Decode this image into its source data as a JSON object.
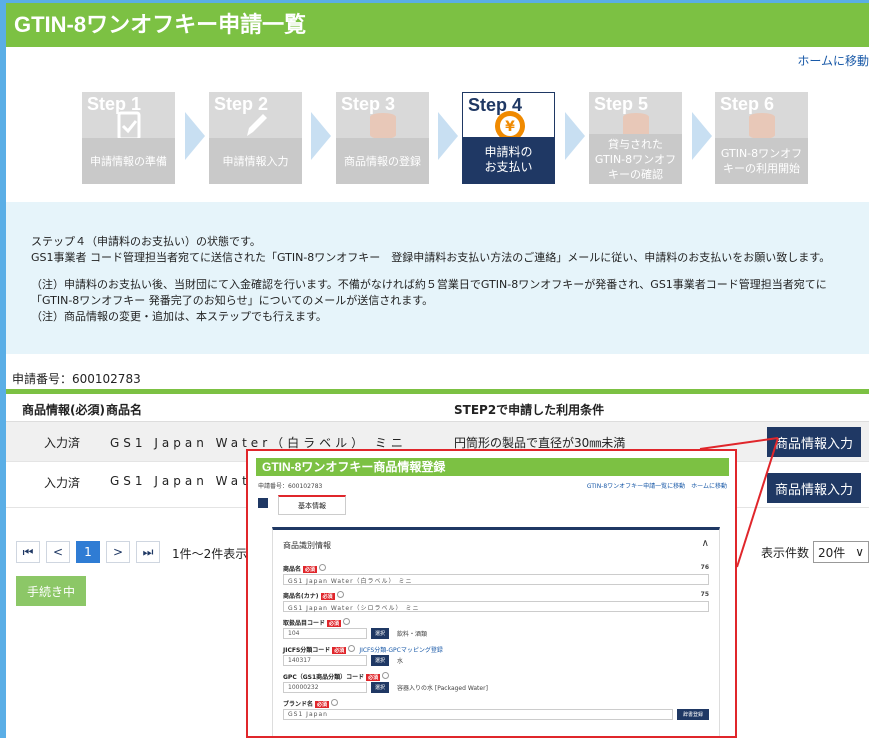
{
  "header": {
    "title": "GTIN-8ワンオフキー申請一覧",
    "home_link": "ホームに移動"
  },
  "steps": [
    {
      "num": "Step 1",
      "label": "申請情報の準備",
      "icon": "clipboard-check-icon"
    },
    {
      "num": "Step 2",
      "label": "申請情報入力",
      "icon": "pencil-icon"
    },
    {
      "num": "Step 3",
      "label": "商品情報の登録",
      "icon": "can-icon"
    },
    {
      "num": "Step 4",
      "label": "申請料の\nお支払い",
      "icon": "yen-icon",
      "active": true
    },
    {
      "num": "Step 5",
      "label": "貸与された\nGTIN-8ワンオフ\nキーの確認",
      "icon": "can-icon"
    },
    {
      "num": "Step 6",
      "label": "GTIN-8ワンオフ\nキーの利用開始",
      "icon": "can-icon"
    }
  ],
  "info": {
    "line1": "ステップ４（申請料のお支払い）の状態です。",
    "line2": "GS1事業者 コード管理担当者宛てに送信された「GTIN-8ワンオフキー　登録申請料お支払い方法のご連絡」メールに従い、申請料のお支払いをお願い致します。",
    "note1": "（注）申請料のお支払い後、当財団にて入金確認を行います。不備がなければ約５営業日でGTIN-8ワンオフキーが発番され、GS1事業者コード管理担当者宛てに「GTIN-8ワンオフキー 発番完了のお知らせ」についてのメールが送信されます。",
    "note2": "（注）商品情報の変更・追加は、本ステップでも行えます。"
  },
  "application_number": "申請番号：600102783",
  "table": {
    "headers": [
      "商品情報(必須)",
      "商品名",
      "STEP2で申請した利用条件"
    ],
    "rows": [
      {
        "status": "入力済",
        "name": "GS1 Japan Water（白ラベル） ミニ",
        "condition": "円筒形の製品で直径が30㎜未満",
        "button": "商品情報入力"
      },
      {
        "status": "入力済",
        "name": "GS1 Japan Wat",
        "condition": "",
        "button": "商品情報入力"
      }
    ]
  },
  "pager": {
    "first": "⏮",
    "prev": "<",
    "current": "1",
    "next": ">",
    "last": "⏭",
    "info": "1件～2件表示/2"
  },
  "display_count": {
    "label": "表示件数",
    "value": "20件"
  },
  "process_button": "手続き中",
  "overlay": {
    "title": "GTIN-8ワンオフキー商品情報登録",
    "app_no": "申請番号：600102783",
    "links": "GTIN-8ワンオフキー申請一覧に移動　ホームに移動",
    "tab": "基本情報",
    "section": "商品識別情報",
    "required": "必須",
    "select": "選択",
    "fields": {
      "name_label": "商品名",
      "name_value": "GS1 Japan Water（白ラベル） ミニ",
      "name_count": "76",
      "kana_label": "商品名(カナ)",
      "kana_value": "GS1 Japan Water（シロラベル） ミニ",
      "kana_count": "75",
      "cat_label": "取扱品目コード",
      "cat_value": "104",
      "cat_desc": "飲料・酒類",
      "jicfs_label": "JICFS分類コード",
      "jicfs_link": "JICFS分類-GPCマッピング登録",
      "jicfs_value": "140317",
      "jicfs_desc": "水",
      "gpc_label": "GPC（GS1商品分類）コード",
      "gpc_value": "10000232",
      "gpc_desc": "容器入りの水 [Packaged Water]",
      "brand_label": "ブランド名",
      "brand_value": "GS1 Japan",
      "brand_btn": "辞書登録"
    }
  }
}
